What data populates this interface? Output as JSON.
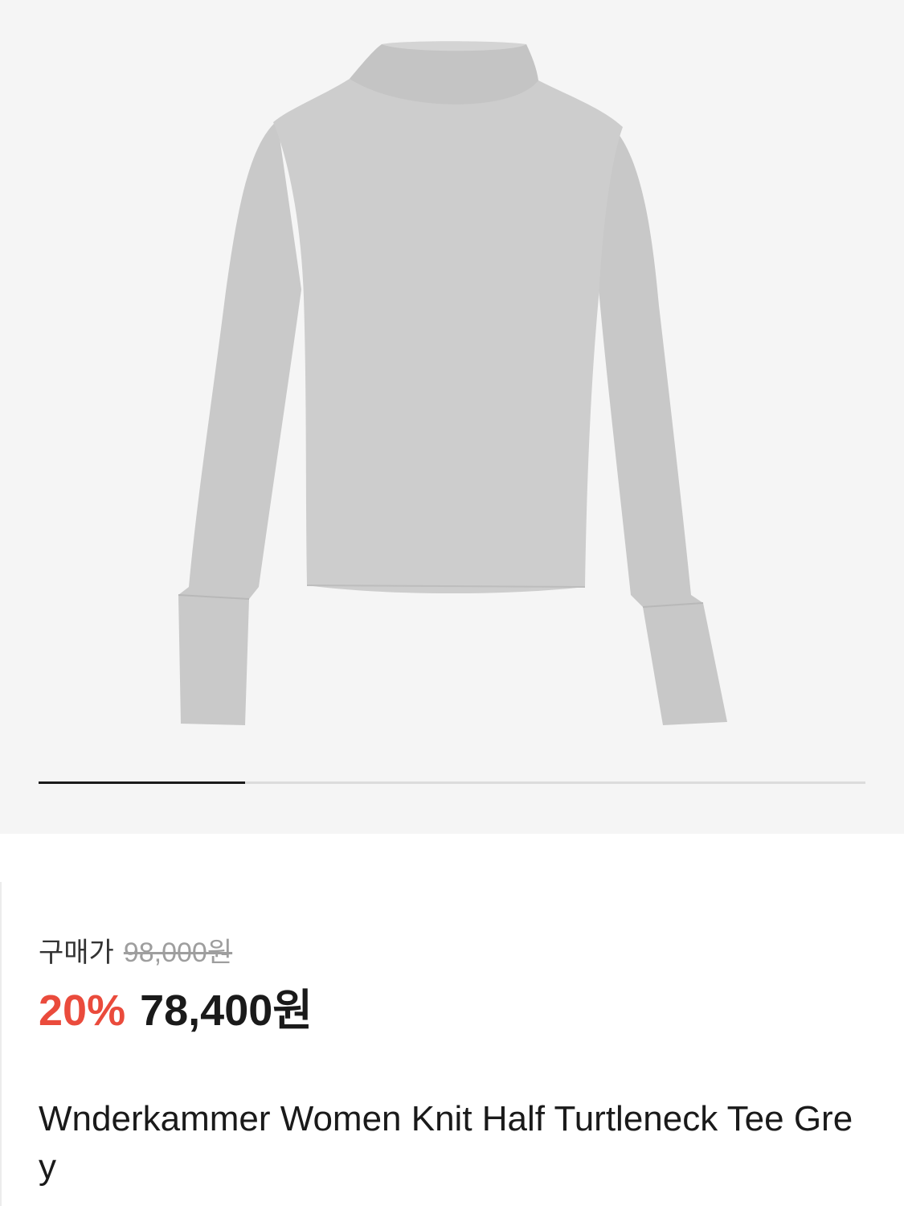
{
  "gallery": {
    "image_alt": "grey half turtleneck knit tee",
    "current_slide": 1,
    "total_slides": 4
  },
  "pricing": {
    "label": "구매가",
    "original_price": "98,000원",
    "discount": "20%",
    "sale_price": "78,400원"
  },
  "product": {
    "name": "Wnderkammer Women Knit Half Turtleneck Tee Grey"
  },
  "colors": {
    "accent_discount": "#ea4b3c",
    "background_gallery": "#f5f5f5",
    "progress_fill": "#1a1a1a",
    "progress_track": "#dcdcdc"
  }
}
